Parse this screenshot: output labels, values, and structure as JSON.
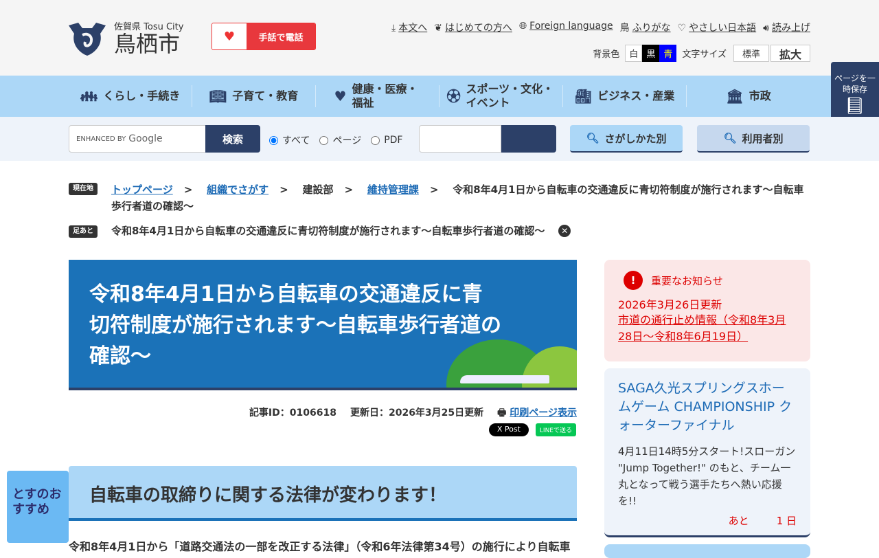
{
  "header": {
    "logo_sub": "佐賀県 Tosu City",
    "logo_main": "鳥栖市",
    "sign_phone": "手話で電話",
    "util": [
      {
        "icon": "download-icon",
        "label": "本文へ"
      },
      {
        "icon": "beginner-icon",
        "label": "はじめての方へ"
      },
      {
        "icon": "globe-icon",
        "label": "Foreign language"
      },
      {
        "icon": "furigana-icon",
        "label": "ふりがな"
      },
      {
        "icon": "heart-icon",
        "label": "やさしい日本語"
      },
      {
        "icon": "speaker-icon",
        "label": "読み上げ"
      }
    ],
    "bg_label": "背景色",
    "bg_options": [
      "白",
      "黒",
      "青"
    ],
    "size_label": "文字サイズ",
    "size_options": [
      "標準",
      "拡大"
    ]
  },
  "save_page": {
    "label": "ページを一時保存"
  },
  "nav": [
    {
      "icon": "family-icon",
      "label": "くらし・手続き"
    },
    {
      "icon": "book-icon",
      "label": "子育て・教育"
    },
    {
      "icon": "heart-icon",
      "label": "健康・医療・福祉"
    },
    {
      "icon": "soccer-ball-icon",
      "label": "スポーツ・文化・イベント"
    },
    {
      "icon": "factory-icon",
      "label": "ビジネス・産業"
    },
    {
      "icon": "city-hall-icon",
      "label": "市政"
    }
  ],
  "search": {
    "google_label": "ENHANCED BY",
    "google_brand": "Google",
    "button": "検索",
    "scopes": [
      "すべて",
      "ページ",
      "PDF"
    ],
    "selected_scope": "すべて",
    "by_method": "さがしかた別",
    "by_user": "利用者別"
  },
  "breadcrumb": {
    "tag": "現在地",
    "items": [
      "トップページ",
      "組織でさがす",
      "建設部",
      "維持管理課"
    ],
    "current": "令和8年4月1日から自転車の交通違反に青切符制度が施行されます～自転車歩行者道の確認～"
  },
  "footprint": {
    "tag": "足あと",
    "item": "令和8年4月1日から自転車の交通違反に青切符制度が施行されます～自転車歩行者道の確認～"
  },
  "article": {
    "title": "令和8年4月1日から自転車の交通違反に青切符制度が施行されます～自転車歩行者道の確認～",
    "id": "記事ID：0106618",
    "updated": "更新日：2026年3月25日更新",
    "print": "印刷ページ表示",
    "x_post": "X Post",
    "line": "LINEで送る",
    "h2": "自転車の取締りに関する法律が変わります！",
    "body": "令和8年4月1日から「道路交通法の一部を改正する法律」（令和6年法律第34号）の施行により自転車"
  },
  "recommend": {
    "label": "とすのおすすめ"
  },
  "important": {
    "title": "重要なお知らせ",
    "date": "2026年3月26日更新",
    "link": "市道の通行止め情報（令和8年3月28日～令和8年6月19日）"
  },
  "event": {
    "title": "SAGA久光スプリングスホームゲーム CHAMPIONSHIP クォーターファイナル",
    "desc": "4月11日14時5分スタート!スローガン \"Jump Together!\" のもと、チーム一丸となって戦う選手たちへ熱い応援を!!",
    "countdown_prefix": "あと",
    "countdown": "1 日"
  },
  "colors": {
    "navy": "#2c4068",
    "nav_bg": "#acd7f7",
    "hero": "#1b72b8",
    "alert": "#dd0000"
  }
}
